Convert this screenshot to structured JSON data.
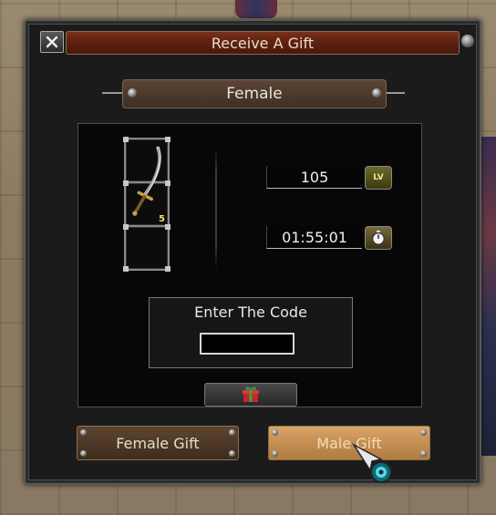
{
  "window": {
    "title": "Receive A Gift",
    "close_label": "X"
  },
  "gender_tab": {
    "label": "Female"
  },
  "reward": {
    "item_icon": "sword-icon",
    "item_count": "5",
    "level": "105",
    "level_badge": "LV",
    "timer": "01:55:01",
    "timer_icon": "stopwatch-icon"
  },
  "code_entry": {
    "label": "Enter The Code",
    "value": ""
  },
  "gift_button_icon": "gift-box-icon",
  "buttons": {
    "female_gift": "Female Gift",
    "male_gift": "Male Gift"
  },
  "colors": {
    "title_bar": "#5c2010",
    "male_button": "#d9a468",
    "female_button": "#5e4530",
    "panel": "#070707"
  }
}
